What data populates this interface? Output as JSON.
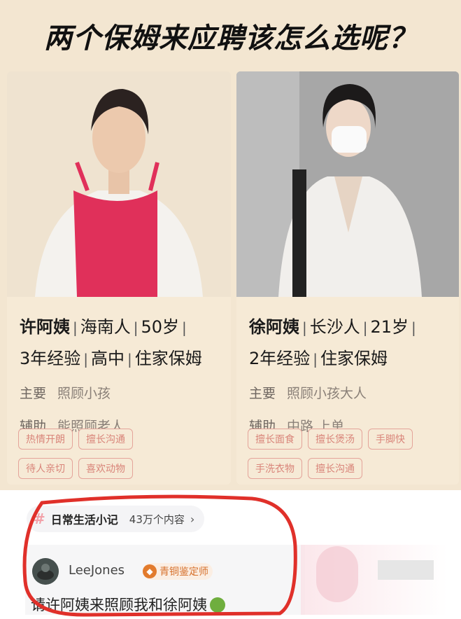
{
  "headline": "两个保姆来应聘该怎么选呢？",
  "left": {
    "name": "许阿姨",
    "origin": "海南人",
    "age": "50岁",
    "experience": "3年经验",
    "education": "高中",
    "type": "住家保姆",
    "main_label": "主要",
    "main_value": "照顾小孩",
    "aux_label": "辅助",
    "aux_value": "能照顾老人",
    "tags": [
      "热情开朗",
      "擅长沟通",
      "待人亲切",
      "喜欢动物"
    ]
  },
  "right": {
    "name": "徐阿姨",
    "origin": "长沙人",
    "age": "21岁",
    "experience": "2年经验",
    "type": "住家保姆",
    "main_label": "主要",
    "main_value": "照顾小孩大人",
    "aux_label": "辅助",
    "aux_value": "中路  上单",
    "tags": [
      "擅长面食",
      "擅长煲汤",
      "手脚快",
      "手洗衣物",
      "擅长沟通"
    ]
  },
  "topic": {
    "name": "日常生活小记",
    "count": "43万个内容",
    "chevron": "›"
  },
  "comment": {
    "username": "LeeJones",
    "badge": "青铜鉴定师",
    "text": "请许阿姨来照顾我和徐阿姨"
  },
  "colors": {
    "tag": "#d9857a",
    "apron": "#e0305a",
    "circle": "#e0302a"
  }
}
